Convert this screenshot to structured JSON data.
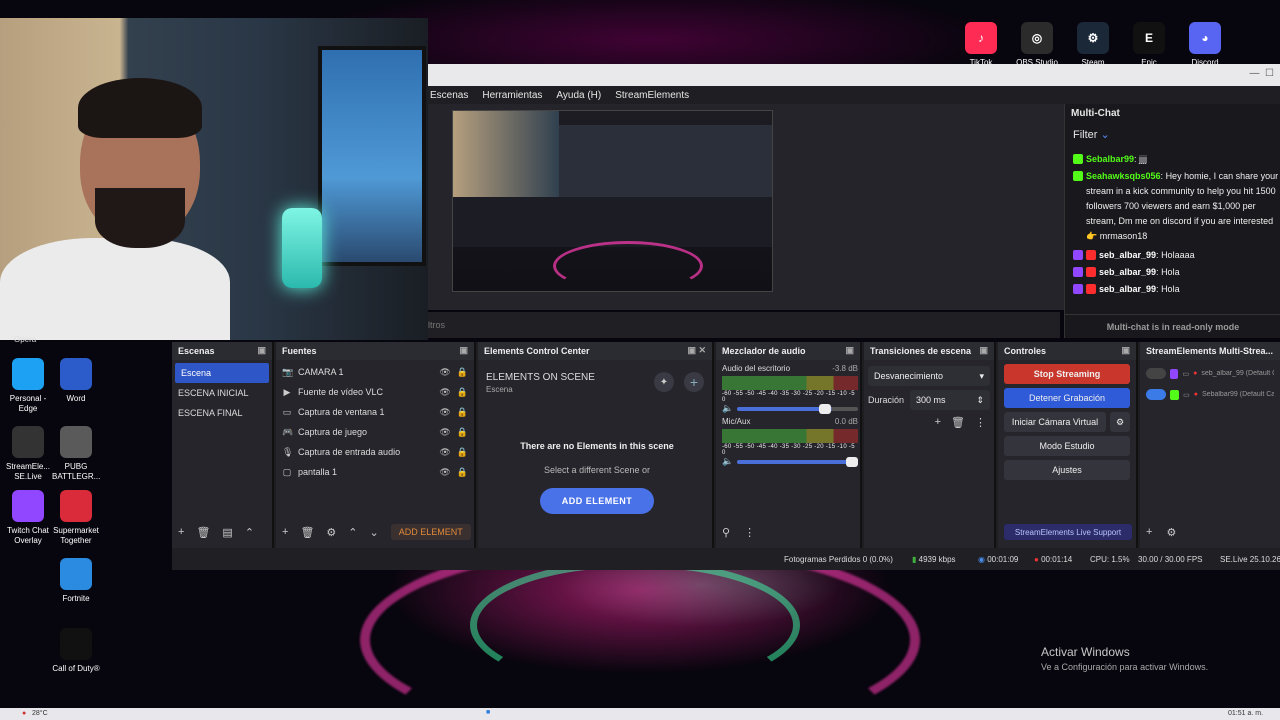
{
  "desktop": {
    "tray_apps": [
      {
        "label": "TikTok LIVE",
        "icon": "tiktok-icon",
        "color": "#fe2c55"
      },
      {
        "label": "OBS Studio",
        "icon": "obs-icon",
        "color": "#2b2b2b"
      },
      {
        "label": "Steam",
        "icon": "steam-icon",
        "color": "#1b2838"
      },
      {
        "label": "Epic Games",
        "icon": "epic-games-icon",
        "color": "#111111"
      },
      {
        "label": "Discord",
        "icon": "discord-icon",
        "color": "#5865f2"
      }
    ],
    "left_icons": [
      {
        "label": "Personal - Edge",
        "color": "#1da1f2"
      },
      {
        "label": "Word",
        "color": "#2b5cc9"
      },
      {
        "label": "StreamEle... SE.Live",
        "color": "#333333"
      },
      {
        "label": "PUBG BATTLEGR...",
        "color": "#5a5a5a"
      },
      {
        "label": "Twitch Chat Overlay",
        "color": "#9147ff"
      },
      {
        "label": "Supermarket Together",
        "color": "#d92b3a"
      },
      {
        "label": "Fortnite",
        "color": "#2a8be0"
      },
      {
        "label": "Call of Duty®",
        "color": "#111111"
      }
    ],
    "opera_label": "Opera",
    "activate_title": "Activar Windows",
    "activate_sub": "Ve a Configuración para activar Windows.",
    "weather": "28°C",
    "clock": "01:51 a. m."
  },
  "obs": {
    "menu": [
      "Escenas",
      "Herramientas",
      "Ayuda (H)",
      "StreamElements"
    ],
    "sources_hint": "ltros",
    "scenes_title": "Escenas",
    "scenes": [
      "Escena",
      "ESCENA INICIAL",
      "ESCENA FINAL"
    ],
    "sources_title": "Fuentes",
    "sources": [
      {
        "name": "CAMARA 1",
        "icon": "camera-icon"
      },
      {
        "name": "Fuente de vídeo VLC",
        "icon": "play-icon"
      },
      {
        "name": "Captura de ventana 1",
        "icon": "window-icon"
      },
      {
        "name": "Captura de juego",
        "icon": "gamepad-icon"
      },
      {
        "name": "Captura de entrada audio",
        "icon": "microphone-icon"
      },
      {
        "name": "pantalla 1",
        "icon": "monitor-icon"
      }
    ],
    "add_element_label": "ADD ELEMENT",
    "ecc_title": "Elements Control Center",
    "ecc_heading": "ELEMENTS ON SCENE",
    "ecc_scene": "Escena",
    "ecc_empty": "There are no Elements in this scene",
    "ecc_hint": "Select a different Scene or",
    "ecc_button": "ADD ELEMENT",
    "mixer_title": "Mezclador de audio",
    "mixer": [
      {
        "name": "Audio del escritorio",
        "db": "-3.8 dB",
        "level": 0.78
      },
      {
        "name": "Mic/Aux",
        "db": "0.0 dB",
        "level": 1.0
      }
    ],
    "mixer_scale": "-60 -55 -50 -45 -40 -35 -30 -25 -20 -15 -10 -5 0",
    "transitions_title": "Transiciones de escena",
    "transition": "Desvanecimiento",
    "duration_label": "Duración",
    "duration_value": "300 ms",
    "controls_title": "Controles",
    "controls": {
      "stop_streaming": "Stop Streaming",
      "stop_recording": "Detener Grabación",
      "virtual_cam": "Iniciar Cámara Virtual",
      "studio_mode": "Modo Estudio",
      "settings": "Ajustes",
      "support": "StreamElements Live Support"
    },
    "multistream_title": "StreamElements Multi-Strea...",
    "multistream": [
      {
        "account": "seb_albar_99",
        "suffix": "(Default C...",
        "enabled": false
      },
      {
        "account": "Sebalbar99",
        "suffix": "(Default Ca...",
        "enabled": true
      }
    ],
    "status": {
      "dropped": "Fotogramas Perdidos 0 (0.0%)",
      "bitrate": "4939 kbps",
      "live_time": "00:01:09",
      "rec_time": "00:01:14",
      "cpu": "CPU: 1.5%",
      "fps": "30.00 / 30.00 FPS",
      "version": "SE.Live 25.10.26"
    }
  },
  "multichat": {
    "title": "Multi-Chat",
    "filter": "Filter",
    "messages": [
      {
        "platform": "kick",
        "name": "Sebalbar99",
        "text": "jjjj",
        "name_color": "#53fc18"
      },
      {
        "platform": "kick",
        "name": "Seahawksqbs056",
        "text": "Hey homie, I can share your stream in a kick community to help you hit 1500 followers 700 viewers and earn $1,000 per stream, Dm me on discord if you are interested 👉 mrmason18",
        "name_color": "#53fc18"
      },
      {
        "platform": "youtube",
        "name": "seb_albar_99",
        "text": "Holaaaa",
        "name_color": "#ffffff"
      },
      {
        "platform": "youtube",
        "name": "seb_albar_99",
        "text": "Hola",
        "name_color": "#ffffff"
      },
      {
        "platform": "youtube",
        "name": "seb_albar_99",
        "text": "Hola",
        "name_color": "#ffffff"
      }
    ],
    "readonly": "Multi-chat is in read-only mode"
  }
}
